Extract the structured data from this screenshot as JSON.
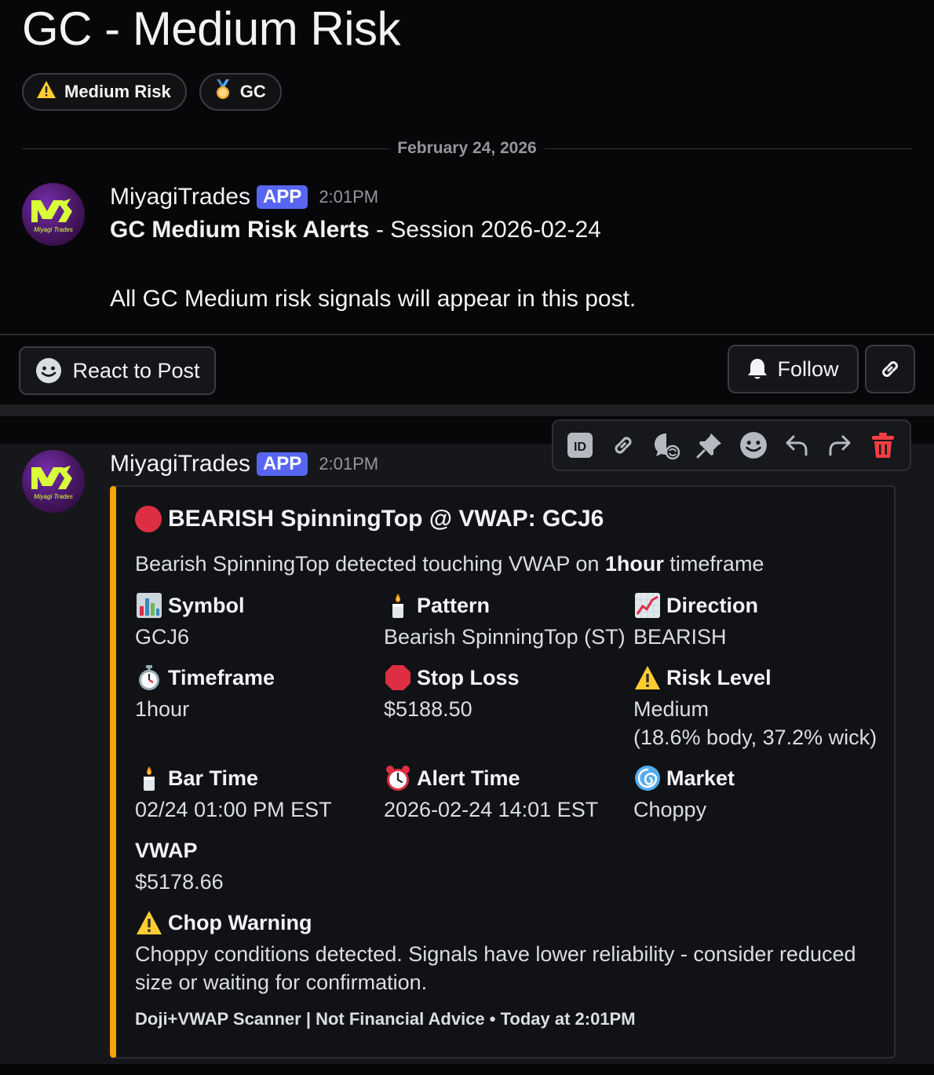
{
  "thread": {
    "title": "GC - Medium Risk",
    "tags": [
      {
        "icon": "warning",
        "label": "Medium Risk"
      },
      {
        "icon": "medal",
        "label": "GC"
      }
    ],
    "date_divider": "February 24, 2026"
  },
  "post": {
    "author": "MiyagiTrades",
    "badge": "APP",
    "time": "2:01PM",
    "avatar_text": "Miyagi Trades",
    "heading_bold": "GC Medium Risk Alerts",
    "heading_rest": " - Session 2026-02-24",
    "body": "All GC Medium risk signals will appear in this post."
  },
  "actions": {
    "react_label": "React to Post",
    "follow_label": "Follow"
  },
  "message": {
    "author": "MiyagiTrades",
    "badge": "APP",
    "time": "2:01PM",
    "avatar_text": "Miyagi Trades",
    "toolbar_icons": [
      "id-icon",
      "link-icon",
      "thread-icon",
      "pin-icon",
      "emoji-icon",
      "reply-icon",
      "forward-icon",
      "trash-icon"
    ]
  },
  "embed": {
    "accent_color": "#f5a30a",
    "title": "BEARISH SpinningTop @ VWAP: GCJ6",
    "desc_pre": "Bearish SpinningTop detected touching VWAP on ",
    "desc_bold": "1hour",
    "desc_post": " timeframe",
    "fields": {
      "symbol": {
        "emoji": "📊",
        "name": "Symbol",
        "value": "GCJ6"
      },
      "pattern": {
        "emoji": "🕯️",
        "name": "Pattern",
        "value": "Bearish SpinningTop (ST)"
      },
      "direction": {
        "emoji": "📈",
        "name": "Direction",
        "value": "BEARISH"
      },
      "timeframe": {
        "emoji": "⏱️",
        "name": "Timeframe",
        "value": "1hour"
      },
      "stop_loss": {
        "emoji": "🛑",
        "name": "Stop Loss",
        "value": "$5188.50"
      },
      "risk_level": {
        "emoji": "⚠️",
        "name": "Risk Level",
        "value": "Medium",
        "value2": "(18.6% body, 37.2% wick)"
      },
      "bar_time": {
        "emoji": "🕯️",
        "name": "Bar Time",
        "value": "02/24 01:00 PM EST"
      },
      "alert_time": {
        "emoji": "⏰",
        "name": "Alert Time",
        "value": "2026-02-24 14:01 EST"
      },
      "market": {
        "emoji": "🌀",
        "name": "Market",
        "value": "Choppy"
      },
      "vwap": {
        "name": "VWAP",
        "value": "$5178.66"
      },
      "chop_warning": {
        "emoji": "⚠️",
        "name": "Chop Warning",
        "value_line1": "Choppy conditions detected. Signals have lower reliability - consider reduced",
        "value_line2": "size or waiting for confirmation."
      }
    },
    "footer": "Doji+VWAP Scanner | Not Financial Advice • Today at 2:01PM"
  }
}
